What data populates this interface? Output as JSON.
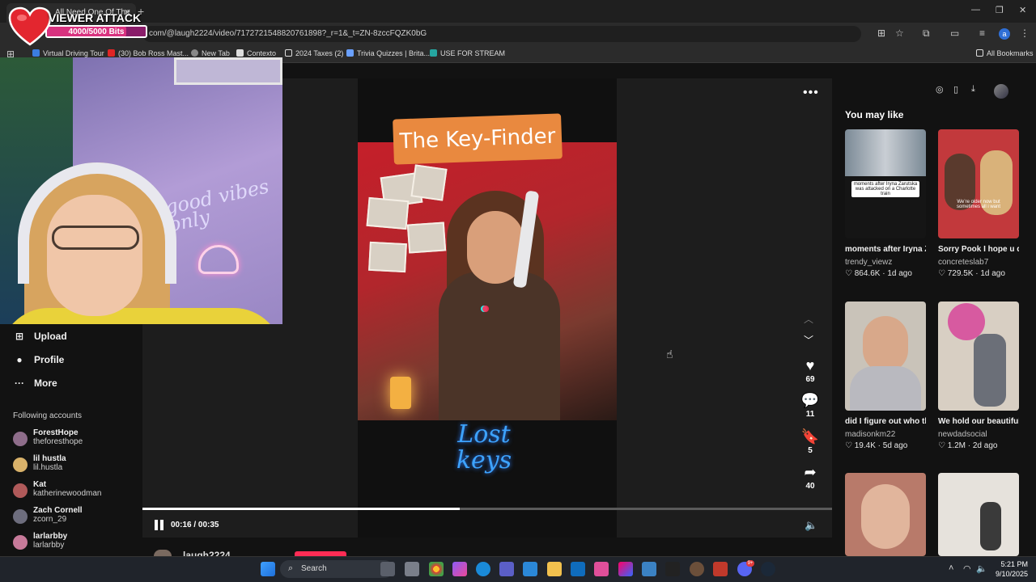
{
  "browser": {
    "tab_title": "All Need One Of The",
    "url": "com/@laugh2224/video/7172721548820761898?_r=1&_t=ZN-8zccFQZK0bG",
    "bookmarks": [
      "Virtual Driving Tour",
      "(30) Bob Ross Mast...",
      "New Tab",
      "Contexto",
      "2024 Taxes (2)",
      "Trivia Quizzes | Brita...",
      "USE FOR STREAM"
    ],
    "all_bookmarks": "All Bookmarks",
    "profile_initial": "a"
  },
  "overlay": {
    "title": "VIEWER ATTACK",
    "bits_text": "4000/5000 Bits",
    "bits_fraction": 0.8,
    "heart_color": "#e3262f",
    "bar_color": "#d8327f"
  },
  "webcam": {
    "neon_text": "good vibes only"
  },
  "nav": {
    "items": [
      {
        "label": "Upload",
        "icon": "plus-square-icon"
      },
      {
        "label": "Profile",
        "icon": "user-icon"
      },
      {
        "label": "More",
        "icon": "ellipsis-icon"
      }
    ],
    "following_header": "Following accounts",
    "accounts": [
      {
        "name": "ForestHope",
        "handle": "theforesthope",
        "color": "#8e6d8a"
      },
      {
        "name": "lil hustla",
        "handle": "lil.hustla",
        "color": "#d9b26a"
      },
      {
        "name": "Kat",
        "handle": "katherinewoodman",
        "color": "#b05a5a"
      },
      {
        "name": "Zach Cornell",
        "handle": "zcorn_29",
        "color": "#6d6d7d"
      },
      {
        "name": "larlarbby",
        "handle": "larlarbby",
        "color": "#c77a9a"
      }
    ]
  },
  "video": {
    "tag_text": "The Key-Finder",
    "logo_text": "Lost keys",
    "likes": "69",
    "comments": "11",
    "saves": "5",
    "shares": "40",
    "time": "00:16 / 00:35",
    "progress_fraction": 0.46,
    "uploader": "laugh2224"
  },
  "rail": {
    "title": "You may like",
    "cards": [
      {
        "title": "moments after Iryna Zarutska was...",
        "user": "trendy_viewz",
        "stat": "864.6K",
        "age": "1d ago",
        "caption": "moments after Iryna Zarutska was attacked on a Charlotte train",
        "bg": "#e9e9e9"
      },
      {
        "title": "Sorry Pook I hope u don’t hate me for...",
        "user": "concreteslab7",
        "stat": "729.5K",
        "age": "1d ago",
        "caption": "We’re older now but sometimes all i want",
        "bg": "#c2393c"
      },
      {
        "title": "did I figure out who the BB mastermind...",
        "user": "madisonkm22",
        "stat": "19.4K",
        "age": "5d ago",
        "caption": "",
        "bg": "#c9c3b9"
      },
      {
        "title": "We hold our beautiful baby girl i...",
        "user": "newdadsocial",
        "stat": "1.2M",
        "age": "2d ago",
        "caption": "",
        "bg": "#d8cfc3"
      },
      {
        "title": "",
        "user": "",
        "stat": "",
        "age": "",
        "caption": "",
        "bg": "#b87a6a"
      },
      {
        "title": "",
        "user": "",
        "stat": "",
        "age": "",
        "caption": "",
        "bg": "#e6e2dc"
      }
    ]
  },
  "taskbar": {
    "search": "Search",
    "time": "5:21 PM",
    "date": "9/10/2025",
    "badge": "9+"
  }
}
